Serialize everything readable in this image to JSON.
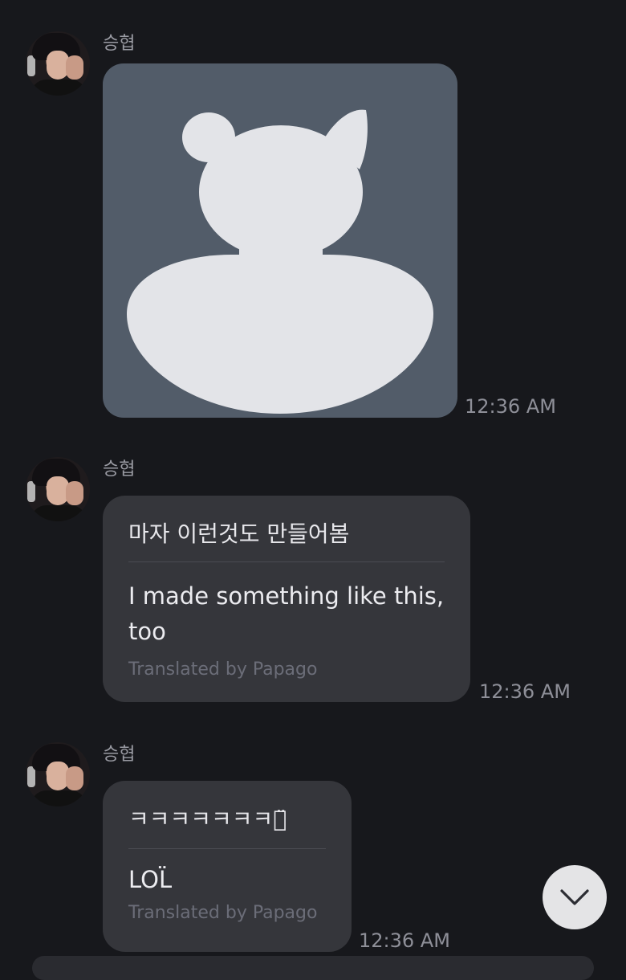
{
  "messages": [
    {
      "sender": "승협",
      "type": "image",
      "image_icon": "bear-silhouette-placeholder",
      "time": "12:36 AM"
    },
    {
      "sender": "승협",
      "type": "text",
      "original": "마자 이런것도 만들어봄",
      "translation": "I made something like this, too",
      "credit": "Translated by Papago",
      "time": "12:36 AM"
    },
    {
      "sender": "승협",
      "type": "text",
      "original": "ㅋㅋㅋㅋㅋㅋㅋㅋ̈",
      "translation": "LOL̈",
      "credit": "Translated by Papago",
      "time": "12:36 AM"
    }
  ],
  "scroll_button": {
    "icon": "chevron-down-icon"
  },
  "colors": {
    "background": "#17181c",
    "bubble": "#35363b",
    "image_bg": "#525c69",
    "silhouette": "#e3e4e8"
  }
}
